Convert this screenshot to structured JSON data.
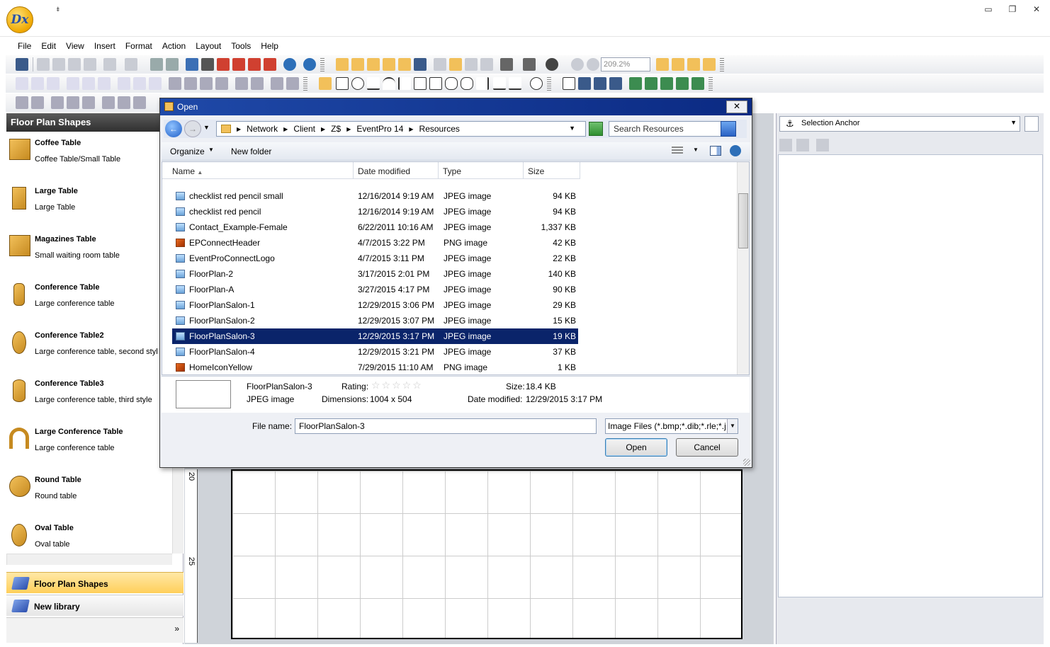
{
  "app": {
    "logo_text": "Dx",
    "qa_glyph": "⇟",
    "minimize": "▭",
    "restore": "❐",
    "close": "✕"
  },
  "menu": [
    "File",
    "Edit",
    "View",
    "Insert",
    "Format",
    "Action",
    "Layout",
    "Tools",
    "Help"
  ],
  "toolbar": {
    "zoom": "209.2%"
  },
  "left_panel": {
    "title": "Floor Plan Shapes",
    "shapes": [
      {
        "title": "Coffee Table",
        "desc": "Coffee Table/Small Table"
      },
      {
        "title": "Large Table",
        "desc": "Large Table"
      },
      {
        "title": "Magazines Table",
        "desc": "Small waiting room table"
      },
      {
        "title": "Conference Table",
        "desc": "Large conference table"
      },
      {
        "title": "Conference Table2",
        "desc": "Large conference table, second styl"
      },
      {
        "title": "Conference Table3",
        "desc": "Large conference table, third style"
      },
      {
        "title": "Large Conference Table",
        "desc": "Large conference table"
      },
      {
        "title": "Round Table",
        "desc": "Round table"
      },
      {
        "title": "Oval Table",
        "desc": "Oval table"
      }
    ],
    "libraries": [
      {
        "label": "Floor Plan Shapes"
      },
      {
        "label": "New library"
      }
    ],
    "more": "»"
  },
  "ruler": {
    "mark_20": "20",
    "mark_25": "25"
  },
  "right_panel": {
    "selector": "Selection Anchor"
  },
  "dialog": {
    "title": "Open",
    "close": "✕",
    "breadcrumb": [
      "Network",
      "Client",
      "Z$",
      "EventPro 14",
      "Resources"
    ],
    "search_placeholder": "Search Resources",
    "organize": "Organize",
    "new_folder": "New folder",
    "columns": {
      "name": "Name",
      "date": "Date modified",
      "type": "Type",
      "size": "Size"
    },
    "files": [
      {
        "name": "checklist red pencil small",
        "date": "12/16/2014 9:19 AM",
        "type": "JPEG image",
        "size": "94 KB",
        "kind": "jpg"
      },
      {
        "name": "checklist red pencil",
        "date": "12/16/2014 9:19 AM",
        "type": "JPEG image",
        "size": "94 KB",
        "kind": "jpg"
      },
      {
        "name": "Contact_Example-Female",
        "date": "6/22/2011 10:16 AM",
        "type": "JPEG image",
        "size": "1,337 KB",
        "kind": "jpg"
      },
      {
        "name": "EPConnectHeader",
        "date": "4/7/2015 3:22 PM",
        "type": "PNG image",
        "size": "42 KB",
        "kind": "png"
      },
      {
        "name": "EventProConnectLogo",
        "date": "4/7/2015 3:11 PM",
        "type": "JPEG image",
        "size": "22 KB",
        "kind": "jpg"
      },
      {
        "name": "FloorPlan-2",
        "date": "3/17/2015 2:01 PM",
        "type": "JPEG image",
        "size": "140 KB",
        "kind": "jpg"
      },
      {
        "name": "FloorPlan-A",
        "date": "3/27/2015 4:17 PM",
        "type": "JPEG image",
        "size": "90 KB",
        "kind": "jpg"
      },
      {
        "name": "FloorPlanSalon-1",
        "date": "12/29/2015 3:06 PM",
        "type": "JPEG image",
        "size": "29 KB",
        "kind": "jpg"
      },
      {
        "name": "FloorPlanSalon-2",
        "date": "12/29/2015 3:07 PM",
        "type": "JPEG image",
        "size": "15 KB",
        "kind": "jpg"
      },
      {
        "name": "FloorPlanSalon-3",
        "date": "12/29/2015 3:17 PM",
        "type": "JPEG image",
        "size": "19 KB",
        "kind": "jpg",
        "selected": true
      },
      {
        "name": "FloorPlanSalon-4",
        "date": "12/29/2015 3:21 PM",
        "type": "JPEG image",
        "size": "37 KB",
        "kind": "jpg"
      },
      {
        "name": "HomeIconYellow",
        "date": "7/29/2015 11:10 AM",
        "type": "PNG image",
        "size": "1 KB",
        "kind": "png"
      }
    ],
    "details": {
      "name": "FloorPlanSalon-3",
      "type": "JPEG image",
      "rating_label": "Rating:",
      "stars": "☆☆☆☆☆",
      "dimensions_label": "Dimensions:",
      "dimensions": "1004 x 504",
      "size_label": "Size:",
      "size": "18.4 KB",
      "modified_label": "Date modified:",
      "modified": "12/29/2015 3:17 PM"
    },
    "filename_label": "File name:",
    "filename": "FloorPlanSalon-3",
    "filetype": "Image Files (*.bmp;*.dib;*.rle;*.j",
    "open": "Open",
    "cancel": "Cancel"
  }
}
